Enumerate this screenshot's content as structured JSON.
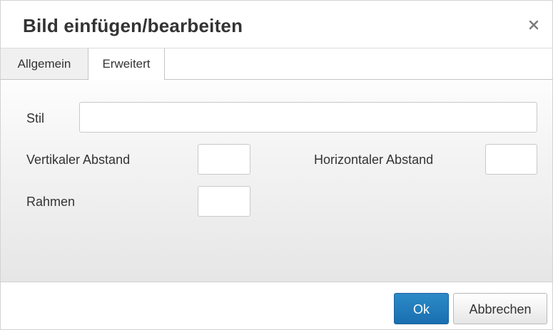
{
  "dialog": {
    "title": "Bild einfügen/bearbeiten",
    "close_icon": "close-icon"
  },
  "tabs": [
    {
      "label": "Allgemein",
      "active": false
    },
    {
      "label": "Erweitert",
      "active": true
    }
  ],
  "form": {
    "style": {
      "label": "Stil",
      "value": ""
    },
    "vspace": {
      "label": "Vertikaler Abstand",
      "value": ""
    },
    "hspace": {
      "label": "Horizontaler Abstand",
      "value": ""
    },
    "border": {
      "label": "Rahmen",
      "value": ""
    }
  },
  "footer": {
    "ok_label": "Ok",
    "cancel_label": "Abbrechen"
  },
  "colors": {
    "primary_button": "#2a83c3",
    "text": "#333333"
  }
}
